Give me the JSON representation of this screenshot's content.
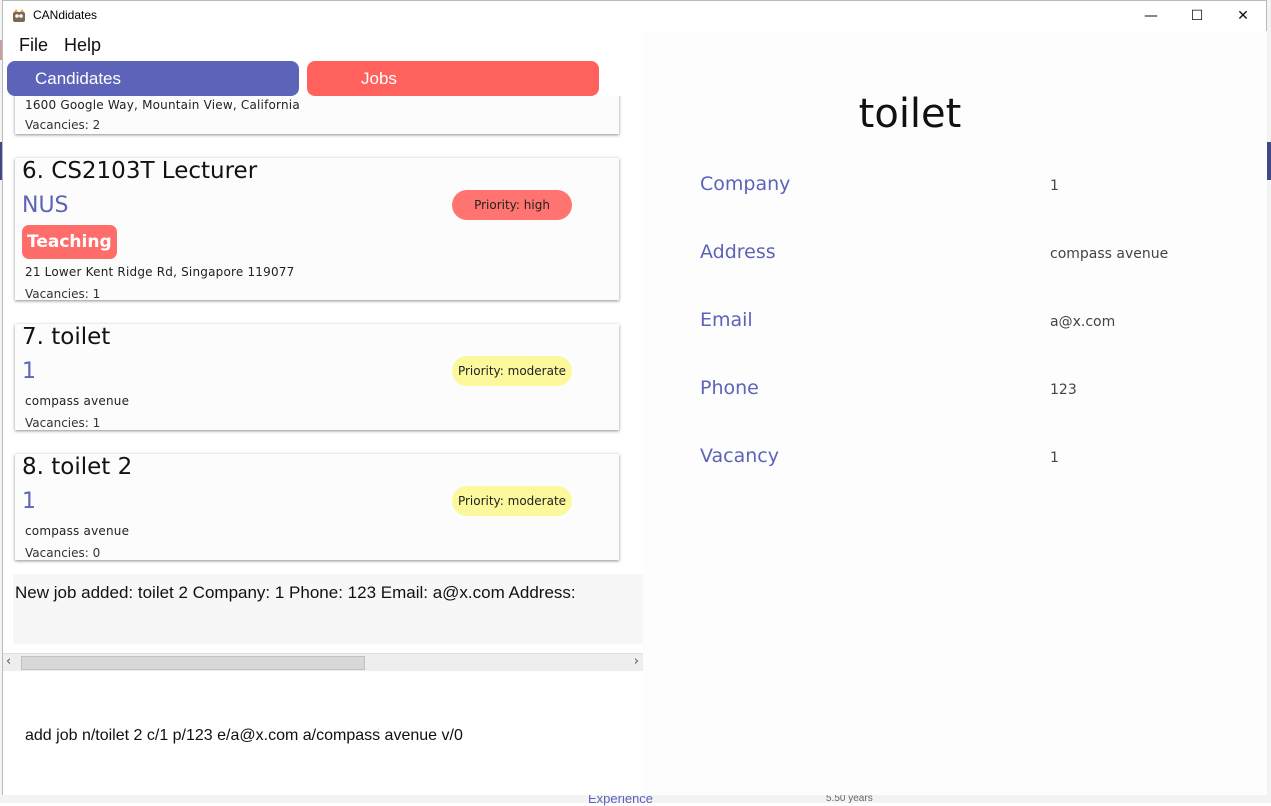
{
  "window": {
    "title": "CANdidates",
    "controls": {
      "minimize": "—",
      "maximize": "☐",
      "close": "✕"
    }
  },
  "menu": [
    "File",
    "Help"
  ],
  "tabs": {
    "candidates": "Candidates",
    "jobs": "Jobs"
  },
  "colors": {
    "accent": "#5c63b9",
    "jobs_tab": "#ff625d",
    "priority_high": "#ff7370",
    "priority_moderate": "#fbf99c",
    "tag": "#ff6d6b"
  },
  "jobs": [
    {
      "title": "",
      "company": "",
      "address": "1600 Google Way, Mountain View, California",
      "vacancies": "Vacancies: 2",
      "priority": ""
    },
    {
      "title": "6.  CS2103T Lecturer",
      "company": "NUS",
      "tag": "Teaching",
      "address": "21 Lower Kent Ridge Rd, Singapore 119077",
      "vacancies": "Vacancies: 1",
      "priority": "Priority: high"
    },
    {
      "title": "7.  toilet",
      "company": "1",
      "address": "compass avenue",
      "vacancies": "Vacancies: 1",
      "priority": "Priority: moderate"
    },
    {
      "title": "8.  toilet 2",
      "company": "1",
      "address": "compass avenue",
      "vacancies": "Vacancies: 0",
      "priority": "Priority: moderate"
    }
  ],
  "result_display": "New job added: toilet 2 Company: 1 Phone: 123 Email: a@x.com Address:",
  "command_box": "add job n/toilet 2 c/1 p/123 e/a@x.com a/compass avenue v/0",
  "detail": {
    "title": "toilet",
    "fields": [
      {
        "label": "Company",
        "value": "1"
      },
      {
        "label": "Address",
        "value": "compass avenue"
      },
      {
        "label": "Email",
        "value": "a@x.com"
      },
      {
        "label": "Phone",
        "value": "123"
      },
      {
        "label": "Vacancy",
        "value": "1"
      }
    ]
  },
  "background": {
    "bottom_label": "Experience",
    "bottom_value": "5.50 years"
  }
}
